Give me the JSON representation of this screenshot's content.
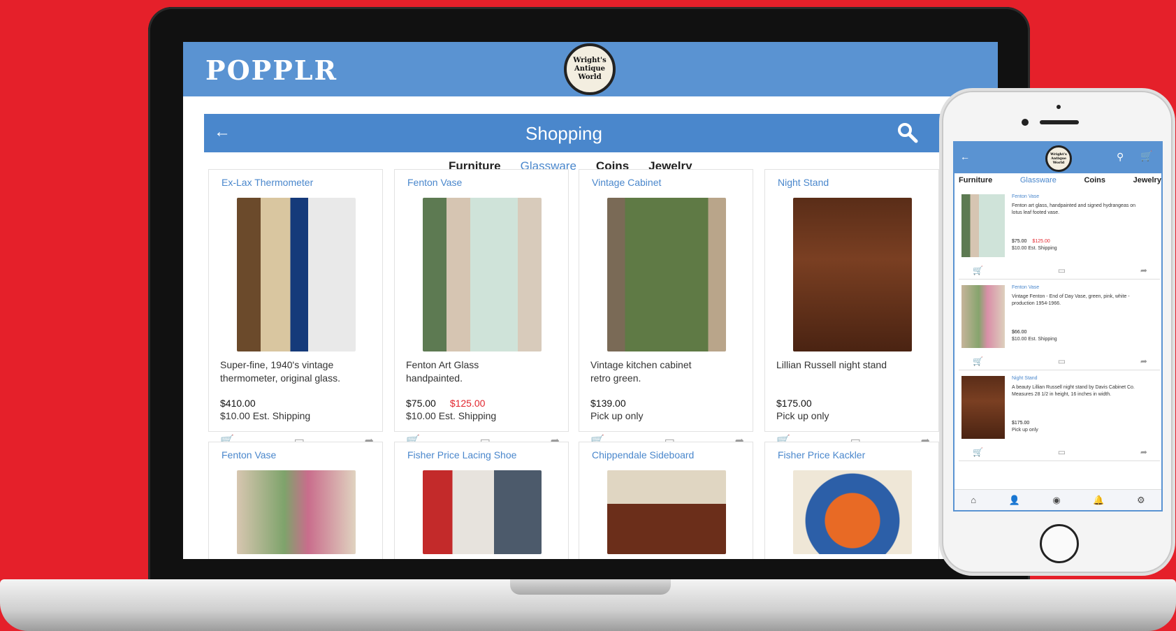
{
  "brand": "POPPLR",
  "store_logo": "Wright's Antique World",
  "header": {
    "title": "Shopping"
  },
  "tabs": [
    "Furniture",
    "Glassware",
    "Coins",
    "Jewelry"
  ],
  "products": [
    {
      "title": "Ex-Lax Thermometer",
      "desc": "Super-fine, 1940's vintage\nthermometer, original glass.",
      "price": "$410.00",
      "old_price": "",
      "ship": "$10.00 Est. Shipping"
    },
    {
      "title": "Fenton Vase",
      "desc": "Fenton Art Glass\nhandpainted.",
      "price": "$75.00",
      "old_price": "$125.00",
      "ship": "$10.00 Est. Shipping"
    },
    {
      "title": "Vintage Cabinet",
      "desc": "Vintage kitchen cabinet\nretro green.",
      "price": "$139.00",
      "old_price": "",
      "ship": "Pick up only"
    },
    {
      "title": "Night Stand",
      "desc": "Lillian Russell night stand",
      "price": "$175.00",
      "old_price": "",
      "ship": "Pick up only"
    },
    {
      "title": "Fenton Vase"
    },
    {
      "title": "Fisher Price Lacing Shoe"
    },
    {
      "title": "Chippendale Sideboard"
    },
    {
      "title": "Fisher Price Kackler"
    }
  ],
  "phone": {
    "tabs": [
      "Furniture",
      "Glassware",
      "Coins",
      "Jewelry"
    ],
    "items": [
      {
        "title": "Fenton Vase",
        "desc": "Fenton art glass, handpainted and signed hydrangeas on lotus leaf footed vase.",
        "price": "$75.00",
        "old_price": "$125.00",
        "ship": "$10.00 Est. Shipping"
      },
      {
        "title": "Fenton Vase",
        "desc": "Vintage Fenton - End of Day Vase, green, pink, white - production 1954-1966.",
        "price": "$66.00",
        "old_price": "",
        "ship": "$10.00 Est. Shipping"
      },
      {
        "title": "Night Stand",
        "desc": "A beauty Lillian Russell night stand by Davis Cabinet Co. Measures 28 1/2 in height, 16 inches in width.",
        "price": "$175.00",
        "old_price": "",
        "ship": "Pick up only"
      }
    ]
  },
  "colors": {
    "background": "#e5202a",
    "brand": "#5a93d2",
    "sale": "#e2262e"
  }
}
